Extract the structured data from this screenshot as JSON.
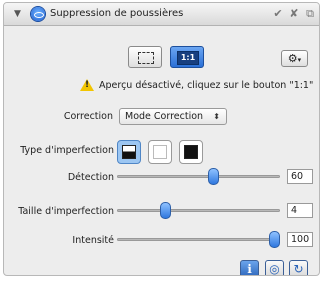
{
  "panel": {
    "title": "Suppression de poussières",
    "disclosure_icon": "▼",
    "header_icons": [
      "✔",
      "✘",
      "⧉"
    ]
  },
  "toolbar": {
    "fit_label": "",
    "one_to_one_label": "1:1",
    "gear_icon": "⚙"
  },
  "warning": {
    "text": "Aperçu désactivé, cliquez sur le bouton \"1:1\""
  },
  "correction": {
    "label": "Correction",
    "value": "Mode Correction",
    "arrow": "⬍"
  },
  "imperfection_type": {
    "label": "Type d'imperfection"
  },
  "sliders": [
    {
      "label": "Détection",
      "value": "60",
      "level": 0.6
    },
    {
      "label": "Taille d'imperfection",
      "value": "4",
      "level": 0.28
    },
    {
      "label": "Intensité",
      "value": "100",
      "level": 1.0
    }
  ],
  "bottom_buttons": [
    {
      "name": "info-button",
      "glyph": "ℹ"
    },
    {
      "name": "preview-button",
      "glyph": "◎"
    },
    {
      "name": "reset-button",
      "glyph": "↻"
    }
  ],
  "colors": {
    "accent": "#2f78df",
    "background": "#ededed",
    "warning": "#f2c500"
  }
}
